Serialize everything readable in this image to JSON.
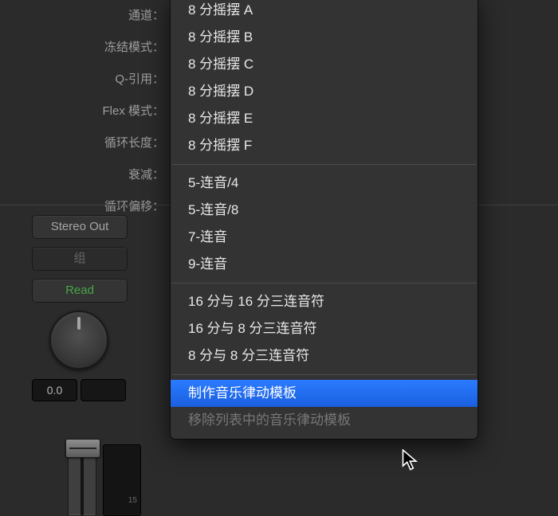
{
  "panel": {
    "rows": [
      "通道：",
      "冻结模式：",
      "Q-引用：",
      "Flex 模式：",
      "循环长度：",
      "衰减：",
      "循环偏移："
    ]
  },
  "buttons": {
    "stereo_out": "Stereo Out",
    "group": "组",
    "read": "Read"
  },
  "knob_value": "0.0",
  "meter_ticks": [
    "15"
  ],
  "menu": {
    "groups": [
      [
        "8 分摇摆 A",
        "8 分摇摆 B",
        "8 分摇摆 C",
        "8 分摇摆 D",
        "8 分摇摆 E",
        "8 分摇摆 F"
      ],
      [
        "5-连音/4",
        "5-连音/8",
        "7-连音",
        "9-连音"
      ],
      [
        "16 分与 16 分三连音符",
        "16 分与 8 分三连音符",
        "8 分与 8 分三连音符"
      ]
    ],
    "footer": {
      "make_template": "制作音乐律动模板",
      "remove_template": "移除列表中的音乐律动模板"
    }
  }
}
